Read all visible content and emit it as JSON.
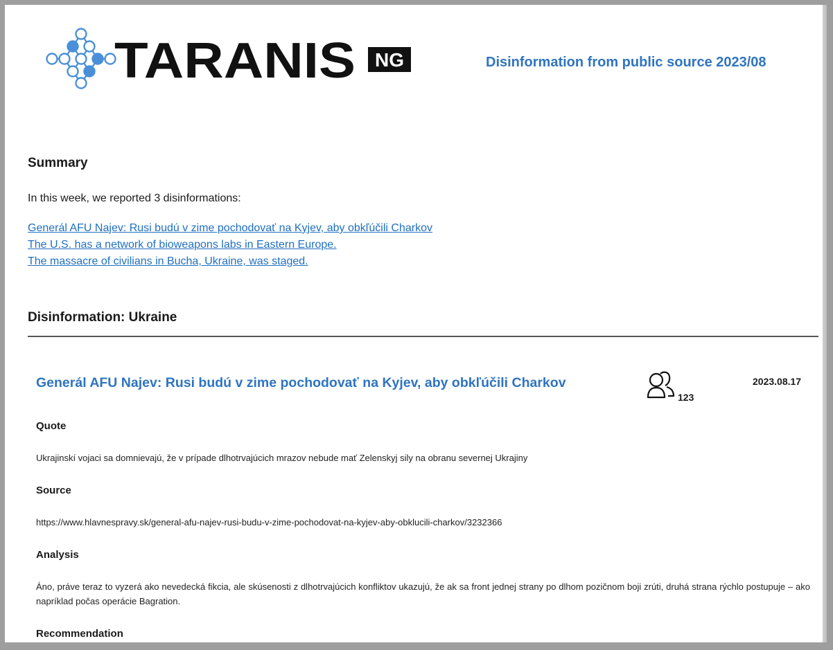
{
  "header": {
    "logo_text": "TARANIS",
    "logo_badge": "NG",
    "report_title": "Disinformation from public source 2023/08"
  },
  "summary": {
    "heading": "Summary",
    "text": "In this week, we reported 3 disinformations:",
    "links": [
      "Generál AFU Najev: Rusi budú v zime pochodovať na Kyjev, aby obkľúčili Charkov",
      "The U.S. has a network of bioweapons labs in Eastern Europe.",
      "The massacre of civilians in Bucha, Ukraine, was staged."
    ]
  },
  "section": {
    "heading": "Disinformation: Ukraine"
  },
  "item": {
    "title": "Generál AFU Najev: Rusi budú v zime pochodovať na Kyjev, aby obkľúčili Charkov",
    "icon": "people-icon",
    "count": "123",
    "date": "2023.08.17",
    "quote_heading": "Quote",
    "quote": "Ukrajinskí vojaci sa domnievajú, že v prípade dlhotrvajúcich mrazov nebude mať Zelenskyj sily na obranu severnej Ukrajiny",
    "source_heading": "Source",
    "source": "https://www.hlavnespravy.sk/general-afu-najev-rusi-budu-v-zime-pochodovat-na-kyjev-aby-obklucili-charkov/3232366",
    "analysis_heading": "Analysis",
    "analysis": "Áno, práve teraz to vyzerá ako nevedecká fikcia, ale skúsenosti z dlhotrvajúcich konfliktov ukazujú, že ak sa front jednej strany po dlhom pozičnom boji zrúti, druhá strana rýchlo postupuje – ako napríklad počas operácie Bagration.",
    "recommendation_heading": "Recommendation"
  },
  "colors": {
    "accent": "#2f74c0",
    "link": "#1f6fc0",
    "logo_blue": "#4a90d9"
  }
}
